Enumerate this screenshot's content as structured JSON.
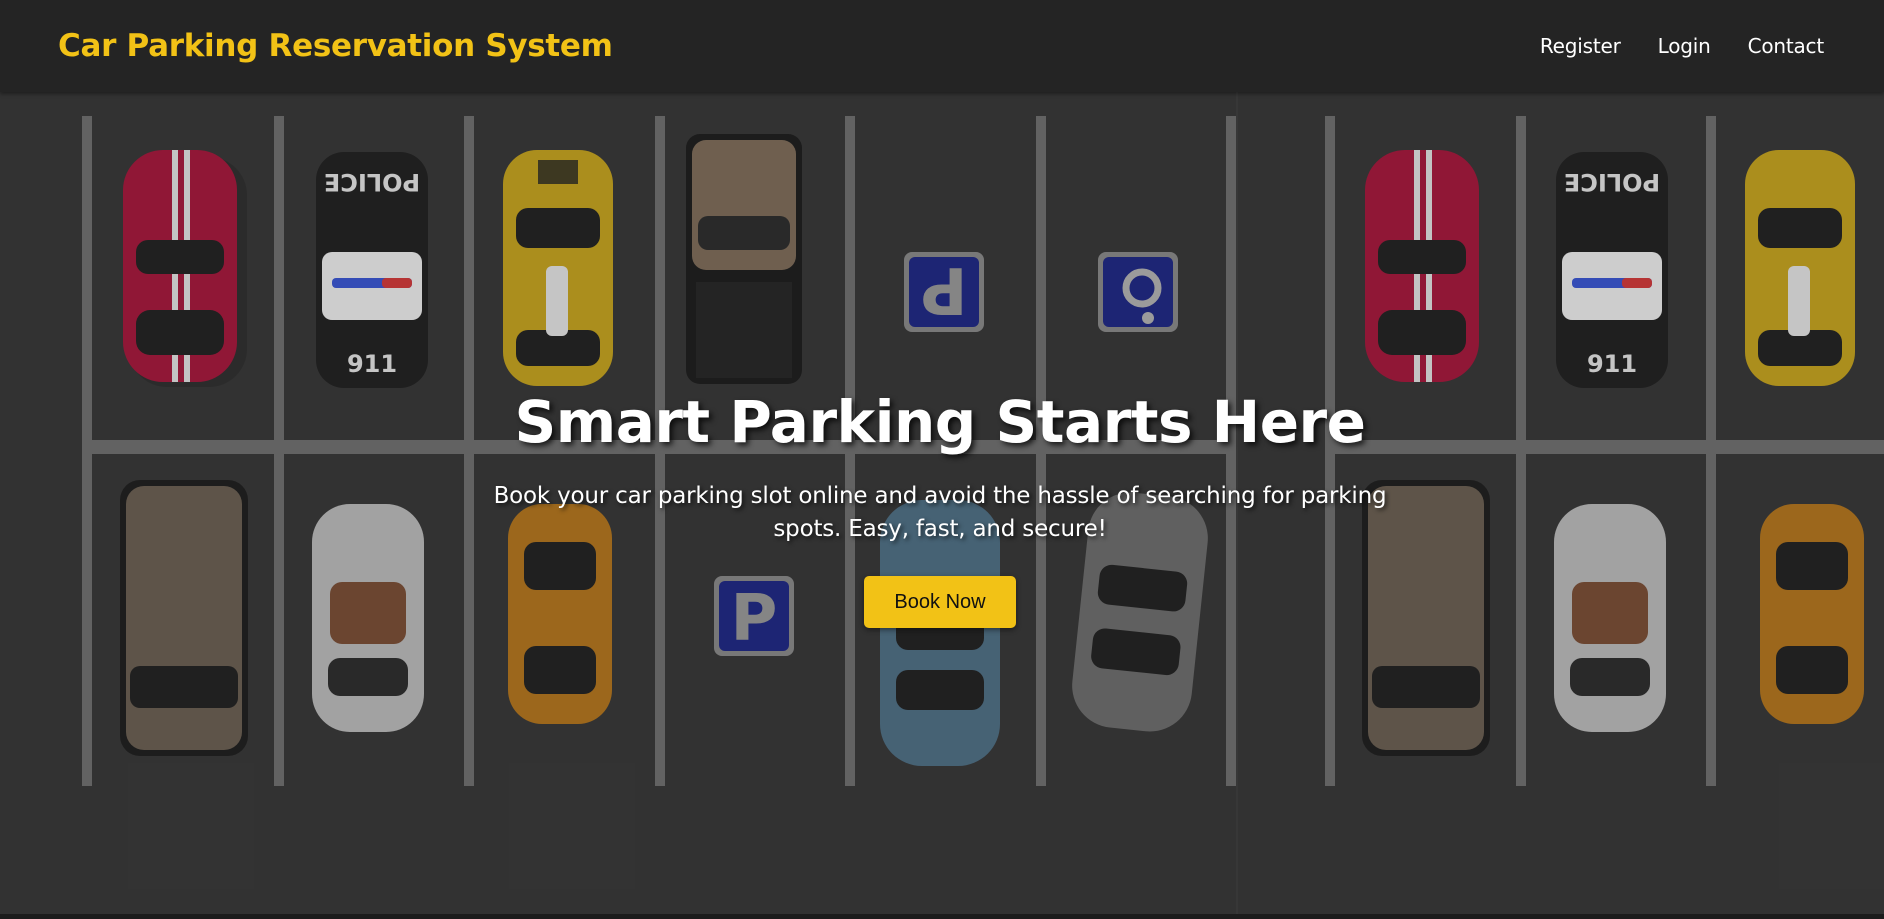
{
  "brand": "Car Parking Reservation System",
  "nav": {
    "register": "Register",
    "login": "Login",
    "contact": "Contact"
  },
  "hero": {
    "title": "Smart Parking Starts Here",
    "subtitle": "Book your car parking slot online and avoid the hassle of searching for parking spots. Easy, fast, and secure!",
    "button": "Book Now"
  },
  "colors": {
    "accent": "#f2c216",
    "navbar": "#242424",
    "asphalt": "#353535"
  }
}
